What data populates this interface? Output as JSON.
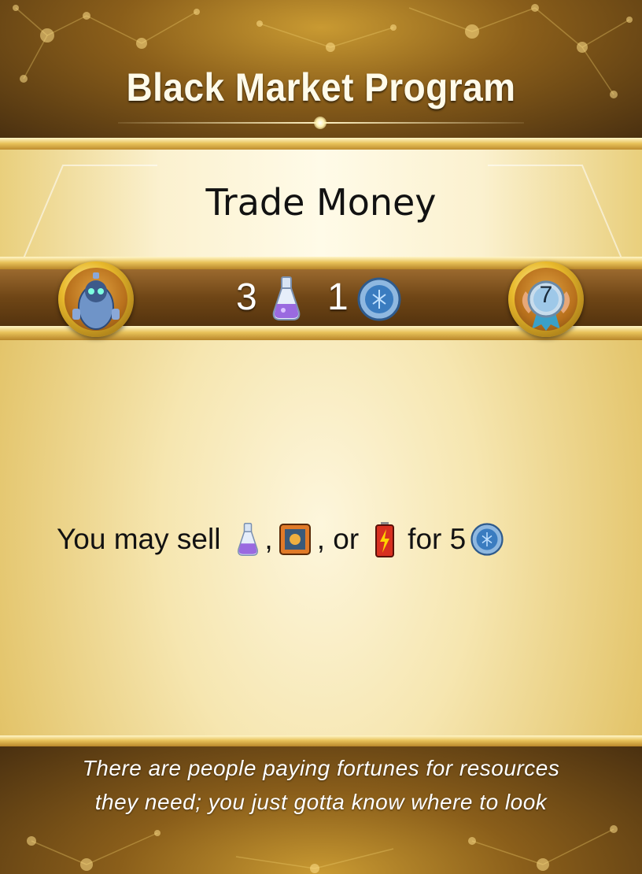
{
  "card": {
    "title": "Black Market Program",
    "name": "Trade Money",
    "cost": {
      "potion_count": "3",
      "coin_count": "1"
    },
    "level": "7",
    "effect": {
      "prefix": "You may sell",
      "sep1": ",",
      "sep2": ", or",
      "suffix": "for 5"
    },
    "flavor": [
      "There are people paying fortunes for resources",
      "they need; you just gotta know where to look"
    ]
  },
  "icons": {
    "left_medallion": "robot-icon",
    "right_medallion": "level-medal-icon",
    "potion": "potion-flask-icon",
    "coin": "coin-icon",
    "crate": "crate-icon",
    "battery": "battery-icon"
  },
  "colors": {
    "header_brown": "#8a5e1a",
    "gold": "#e8c25a",
    "cost_bar": "#6f4616",
    "text_dark": "#121212",
    "potion_purple": "#9a6ae0",
    "coin_blue": "#3a7cc0"
  }
}
